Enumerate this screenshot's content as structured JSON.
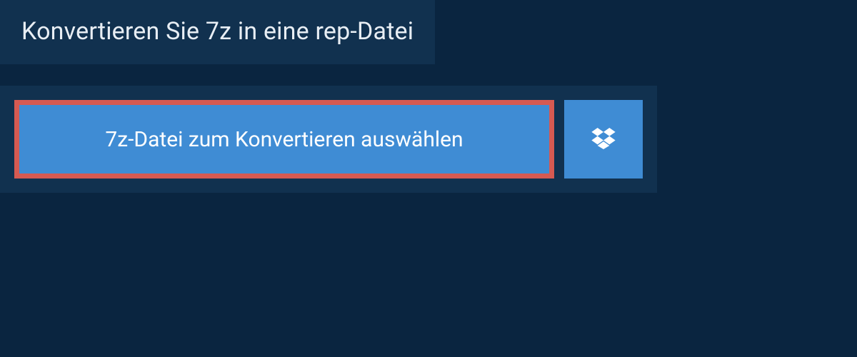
{
  "header": {
    "title": "Konvertieren Sie 7z in eine rep-Datei"
  },
  "actions": {
    "select_file_label": "7z-Datei zum Konvertieren auswählen"
  },
  "colors": {
    "background": "#0a2540",
    "panel": "#11314f",
    "button": "#3f8cd4",
    "highlight_border": "#d65a52"
  }
}
